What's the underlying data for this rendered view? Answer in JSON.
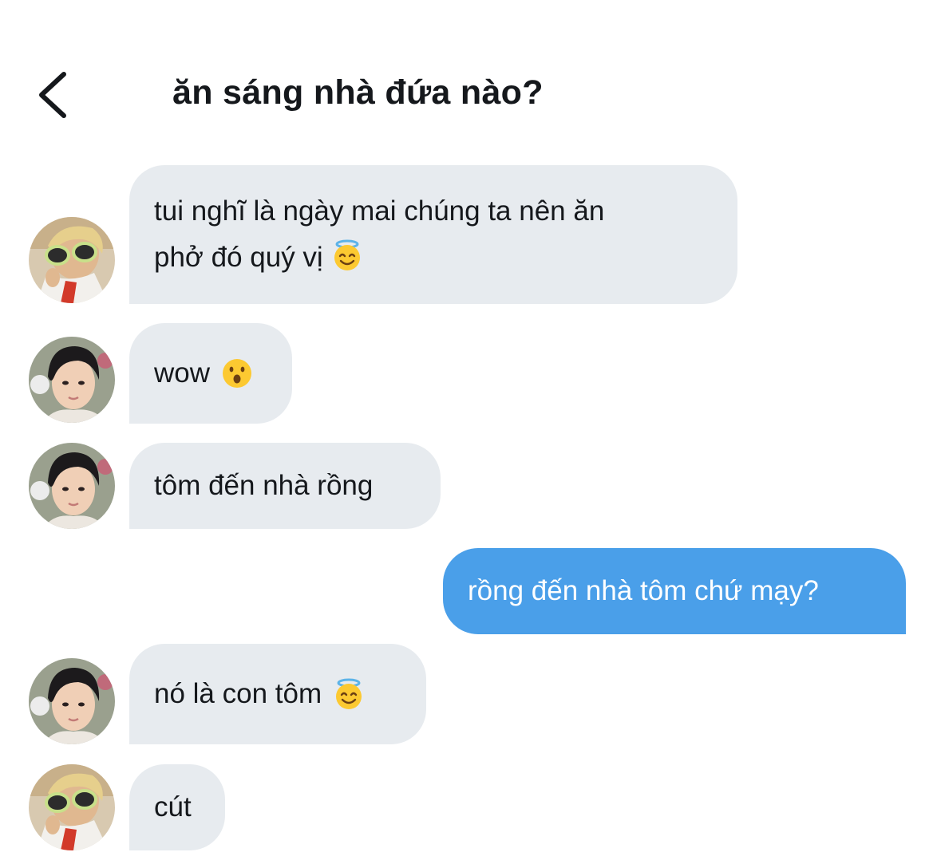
{
  "header": {
    "title": "ăn sáng nhà đứa nào?",
    "back_icon": "chevron-left-icon"
  },
  "colors": {
    "incoming_bubble": "#e7ebef",
    "outgoing_bubble": "#4a9fe9",
    "text": "#15181c"
  },
  "messages": [
    {
      "sender": "avatar-blond",
      "direction": "incoming",
      "lines": [
        "tui nghĩ là ngày mai chúng ta nên ăn",
        "phở đó quý vị"
      ],
      "emoji": "smiling-face-with-halo-emoji"
    },
    {
      "sender": "avatar-dark-hair",
      "direction": "incoming",
      "text": "wow",
      "emoji": "hushed-face-emoji"
    },
    {
      "sender": "avatar-dark-hair",
      "direction": "incoming",
      "text": "tôm đến nhà rồng"
    },
    {
      "direction": "outgoing",
      "text": "rồng đến nhà tôm chứ mạy?"
    },
    {
      "sender": "avatar-dark-hair",
      "direction": "incoming",
      "text": "nó là con tôm",
      "emoji": "smiling-face-with-halo-emoji"
    },
    {
      "sender": "avatar-blond",
      "direction": "incoming",
      "text": "cút"
    }
  ]
}
